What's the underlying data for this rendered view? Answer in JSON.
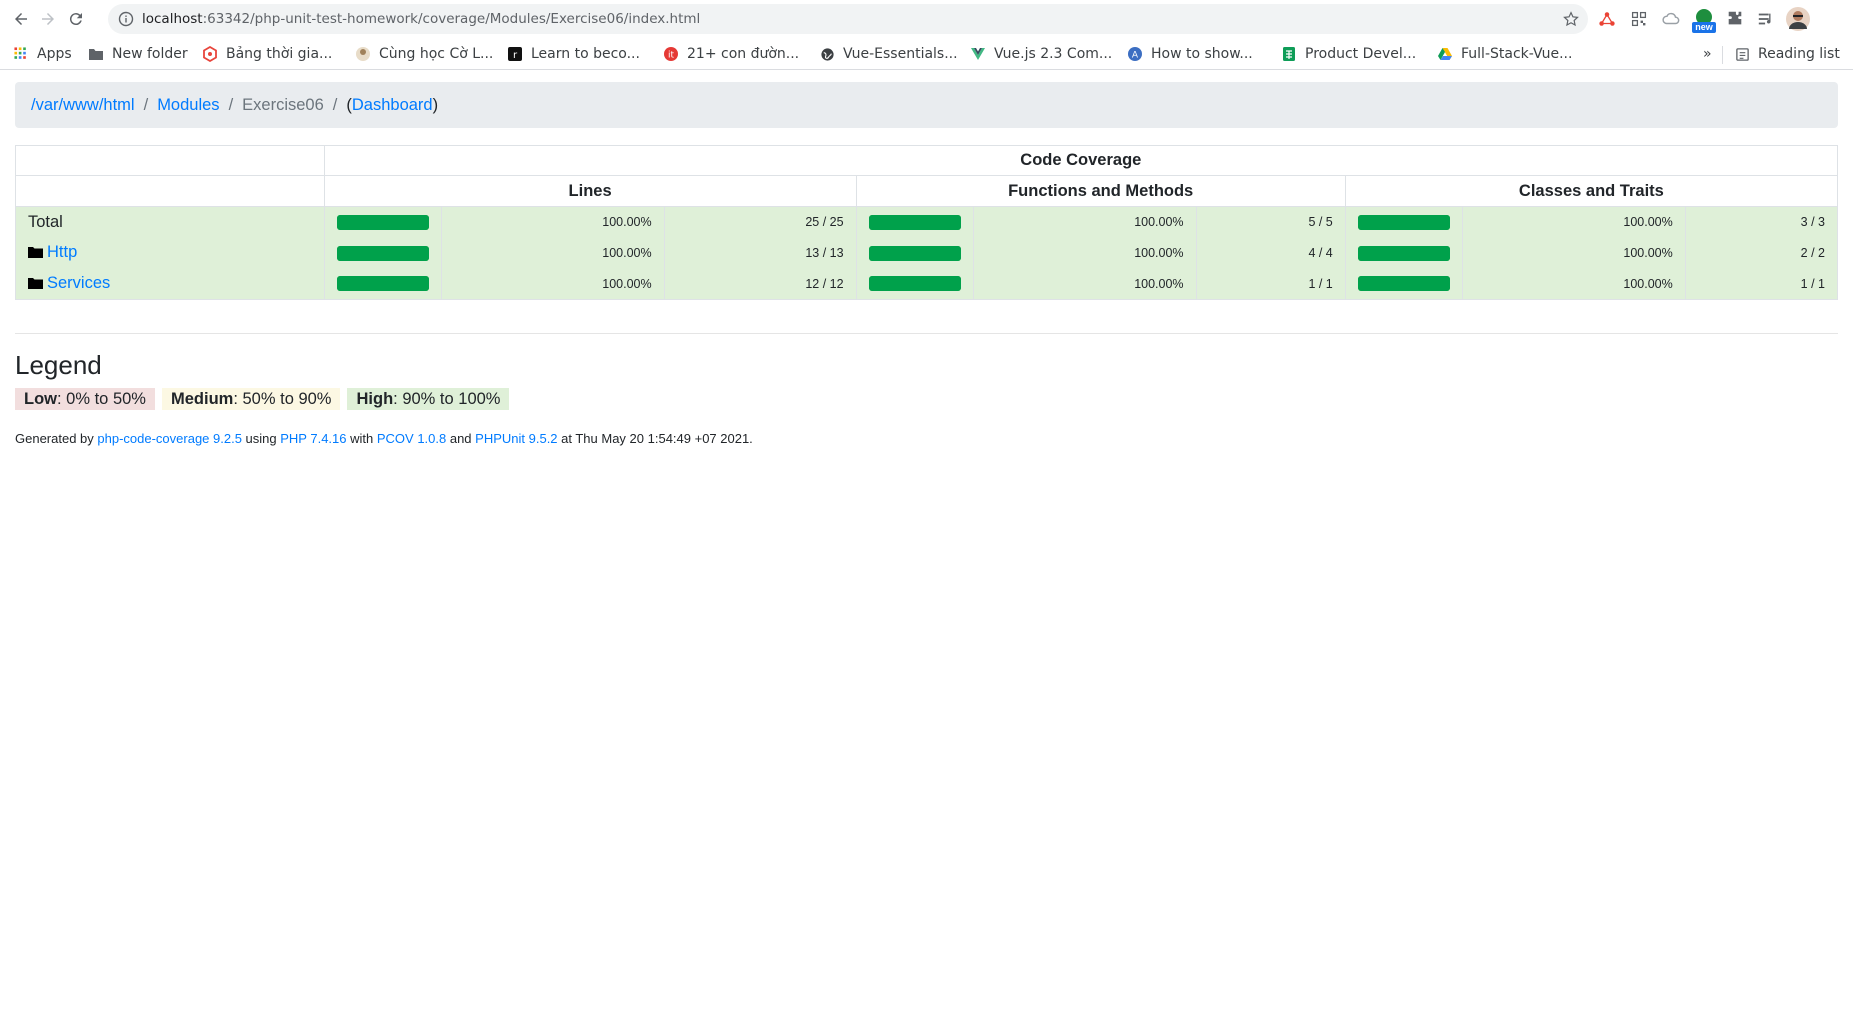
{
  "browser": {
    "url_host": "localhost",
    "url_path": ":63342/php-unit-test-homework/coverage/Modules/Exercise06/index.html",
    "extensions": [
      "network-icon",
      "qr-icon",
      "cloud-icon",
      "new-badge-extension-icon",
      "puzzle-icon",
      "media-icon",
      "avatar"
    ],
    "new_badge": "new",
    "bookmarks": [
      {
        "label": "Apps",
        "icon": "apps-grid-icon"
      },
      {
        "label": "New folder",
        "icon": "folder-icon"
      },
      {
        "label": "Bảng thời gia...",
        "icon": "red-hex-icon"
      },
      {
        "label": "Cùng học Cờ L...",
        "icon": "character-icon"
      },
      {
        "label": "Learn to beco...",
        "icon": "r-square-icon"
      },
      {
        "label": "21+ con đườn...",
        "icon": "red-circle-icon"
      },
      {
        "label": "Vue-Essentials...",
        "icon": "globe-icon"
      },
      {
        "label": "Vue.js 2.3 Com...",
        "icon": "vue-icon"
      },
      {
        "label": "How to show...",
        "icon": "a-circle-icon"
      },
      {
        "label": "Product Devel...",
        "icon": "sheet-icon"
      },
      {
        "label": "Full-Stack-Vue...",
        "icon": "drive-icon"
      }
    ],
    "more": "»",
    "reading_list": "Reading list"
  },
  "breadcrumb": {
    "items": [
      "/var/www/html",
      "Modules",
      "Exercise06"
    ],
    "dashboard": "Dashboard",
    "separator": "/",
    "open_paren": "(",
    "close_paren": ")"
  },
  "table": {
    "header_main": "Code Coverage",
    "headers": [
      "Lines",
      "Functions and Methods",
      "Classes and Traits"
    ],
    "rows": [
      {
        "name": "Total",
        "is_dir": false,
        "lines_pct": "100.00%",
        "lines_ratio": "25 / 25",
        "lines_fill": 1.0,
        "funcs_pct": "100.00%",
        "funcs_ratio": "5 / 5",
        "funcs_fill": 1.0,
        "classes_pct": "100.00%",
        "classes_ratio": "3 / 3",
        "classes_fill": 1.0
      },
      {
        "name": "Http",
        "is_dir": true,
        "lines_pct": "100.00%",
        "lines_ratio": "13 / 13",
        "lines_fill": 1.0,
        "funcs_pct": "100.00%",
        "funcs_ratio": "4 / 4",
        "funcs_fill": 1.0,
        "classes_pct": "100.00%",
        "classes_ratio": "2 / 2",
        "classes_fill": 1.0
      },
      {
        "name": "Services",
        "is_dir": true,
        "lines_pct": "100.00%",
        "lines_ratio": "12 / 12",
        "lines_fill": 1.0,
        "funcs_pct": "100.00%",
        "funcs_ratio": "1 / 1",
        "funcs_fill": 1.0,
        "classes_pct": "100.00%",
        "classes_ratio": "1 / 1",
        "classes_fill": 1.0
      }
    ]
  },
  "legend": {
    "title": "Legend",
    "low_label": "Low",
    "low_range": ": 0% to 50%",
    "medium_label": "Medium",
    "medium_range": ": 50% to 90%",
    "high_label": "High",
    "high_range": ": 90% to 100%"
  },
  "footer": {
    "generated_by": "Generated by ",
    "tool": "php-code-coverage 9.2.5",
    "using": " using ",
    "php": "PHP 7.4.16",
    "with": " with ",
    "driver": "PCOV 1.0.8",
    "and": " and ",
    "phpunit": "PHPUnit 9.5.2",
    "at": " at Thu May 20 1:54:49 +07 2021."
  },
  "colors": {
    "high_bg": "#dff0d8",
    "bar": "#00a14b",
    "link": "#007bff",
    "breadcrumb_bg": "#e9ecef"
  }
}
